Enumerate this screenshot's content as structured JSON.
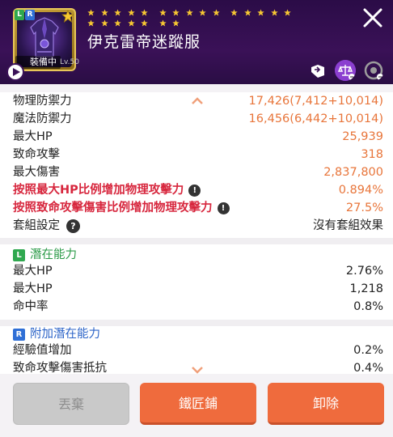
{
  "item": {
    "name": "伊克雷帝迷蹤服",
    "equipped_label": "裝備中",
    "level": "Lv.50",
    "star_count": 22,
    "badges": {
      "left": "L",
      "right": "R"
    }
  },
  "header_icons": [
    "transfer-icon",
    "scale-icon",
    "lock-icon"
  ],
  "stats": [
    {
      "label": "物理防禦力",
      "value": "17,426(7,412+10,014)",
      "style": "orange"
    },
    {
      "label": "魔法防禦力",
      "value": "16,456(6,442+10,014)",
      "style": "orange"
    },
    {
      "label": "最大HP",
      "value": "25,939",
      "style": "orange"
    },
    {
      "label": "致命攻擊",
      "value": "318",
      "style": "orange"
    },
    {
      "label": "最大傷害",
      "value": "2,837,800",
      "style": "orange"
    },
    {
      "label": "按照最大HP比例增加物理攻擊力",
      "value": "0.894%",
      "style": "red",
      "info": "!"
    },
    {
      "label": "按照致命攻擊傷害比例增加物理攻擊力",
      "value": "27.5%",
      "style": "red",
      "info": "!"
    },
    {
      "label": "套組設定",
      "value": "沒有套組效果",
      "style": "plain",
      "help": "?"
    }
  ],
  "potential": {
    "badge": "L",
    "title": "潛在能力",
    "rows": [
      {
        "label": "最大HP",
        "value": "2.76%"
      },
      {
        "label": "最大HP",
        "value": "1,218"
      },
      {
        "label": "命中率",
        "value": "0.8%"
      }
    ]
  },
  "additional_potential": {
    "badge": "R",
    "title": "附加潛在能力",
    "rows": [
      {
        "label": "經驗值增加",
        "value": "0.2%"
      },
      {
        "label": "致命攻擊傷害抵抗",
        "value": "0.4%"
      }
    ]
  },
  "buttons": {
    "discard": "丟棄",
    "blacksmith": "鐵匠鋪",
    "unequip": "卸除"
  },
  "colors": {
    "header_bg": "#3a1157",
    "accent_orange": "#e8753a",
    "warning_red": "#d7263d",
    "potential_green": "#2a9a47",
    "additional_blue": "#2c64c8",
    "button_orange": "#ef6b3d"
  }
}
